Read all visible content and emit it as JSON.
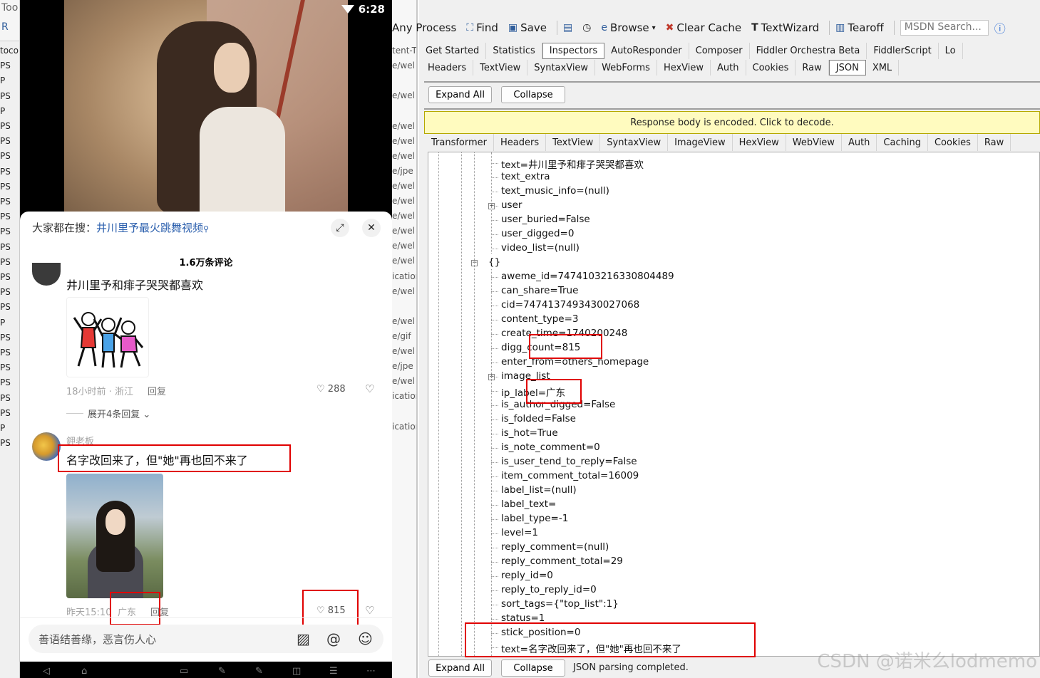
{
  "left_sliver": {
    "toolbar_text": "Too",
    "toolbar_text2": "R",
    "rows": [
      "tocol",
      "PS",
      "P",
      "PS",
      "P",
      "PS",
      "PS",
      "PS",
      "PS",
      "PS",
      "PS",
      "PS",
      "PS",
      "PS",
      "PS",
      "PS",
      "PS",
      "PS",
      "P",
      "PS",
      "PS",
      "PS",
      "PS",
      "PS",
      "PS",
      "P",
      "PS"
    ]
  },
  "phone": {
    "time": "6:28",
    "search_prefix": "大家都在搜：",
    "search_link": "井川里予最火跳舞视频",
    "comment_count": "1.6万条评论",
    "comments": [
      {
        "text": "井川里予和痱子哭哭都喜欢",
        "meta": "18小时前 · 浙江",
        "reply": "回复",
        "likes": "288",
        "expand": "展开4条回复"
      },
      {
        "author": "鉀老板",
        "text": "名字改回来了，但\"她\"再也回不来了",
        "meta_time": "昨天15:10",
        "meta_loc": "广东",
        "reply": "回复",
        "likes": "815"
      }
    ],
    "input_placeholder": "善语结善缘，恶言伤人心"
  },
  "mid_sliver": {
    "rows": [
      "tent-T",
      "e/wel",
      "",
      "e/wel",
      "",
      "e/wel",
      "e/wel",
      "e/wel",
      "e/jpe",
      "e/wel",
      "e/wel",
      "e/wel",
      "e/wel",
      "e/wel",
      "e/wel",
      "ication",
      "e/wel",
      "",
      "e/wel",
      "e/gif",
      "e/wel",
      "e/jpe",
      "e/wel",
      "ication",
      "",
      "ication"
    ]
  },
  "fiddler": {
    "toolbar": [
      "Any Process",
      "Find",
      "Save",
      "Browse",
      "Clear Cache",
      "TextWizard",
      "Tearoff"
    ],
    "msdn_placeholder": "MSDN Search...",
    "top_tabs": [
      "Get Started",
      "Statistics",
      "Inspectors",
      "AutoResponder",
      "Composer",
      "Fiddler Orchestra Beta",
      "FiddlerScript",
      "Lo"
    ],
    "request_tabs": [
      "Headers",
      "TextView",
      "SyntaxView",
      "WebForms",
      "HexView",
      "Auth",
      "Cookies",
      "Raw",
      "JSON",
      "XML"
    ],
    "expand_all": "Expand All",
    "collapse": "Collapse",
    "encoded_notice": "Response body is encoded. Click to decode.",
    "response_tabs": [
      "Transformer",
      "Headers",
      "TextView",
      "SyntaxView",
      "ImageView",
      "HexView",
      "WebView",
      "Auth",
      "Caching",
      "Cookies",
      "Raw"
    ],
    "tree_lines": [
      "text=井川里予和痱子哭哭都喜欢",
      "text_extra",
      "text_music_info=(null)",
      "user",
      "user_buried=False",
      "user_digged=0",
      "video_list=(null)",
      "{}",
      "aweme_id=7474103216330804489",
      "can_share=True",
      "cid=7474137493430027068",
      "content_type=3",
      "create_time=1740200248",
      "digg_count=815",
      "enter_from=others_homepage",
      "image_list",
      "ip_label=广东",
      "is_author_digged=False",
      "is_folded=False",
      "is_hot=True",
      "is_note_comment=0",
      "is_user_tend_to_reply=False",
      "item_comment_total=16009",
      "label_list=(null)",
      "label_text=",
      "label_type=-1",
      "level=1",
      "reply_comment=(null)",
      "reply_comment_total=29",
      "reply_id=0",
      "reply_to_reply_id=0",
      "sort_tags={\"top_list\":1}",
      "status=1",
      "stick_position=0",
      "text=名字改回来了，但\"她\"再也回不来了"
    ],
    "bottom_expand_all": "Expand All",
    "bottom_collapse": "Collapse",
    "status": "JSON parsing completed."
  },
  "watermark": "CSDN @诺米么lodmemo"
}
